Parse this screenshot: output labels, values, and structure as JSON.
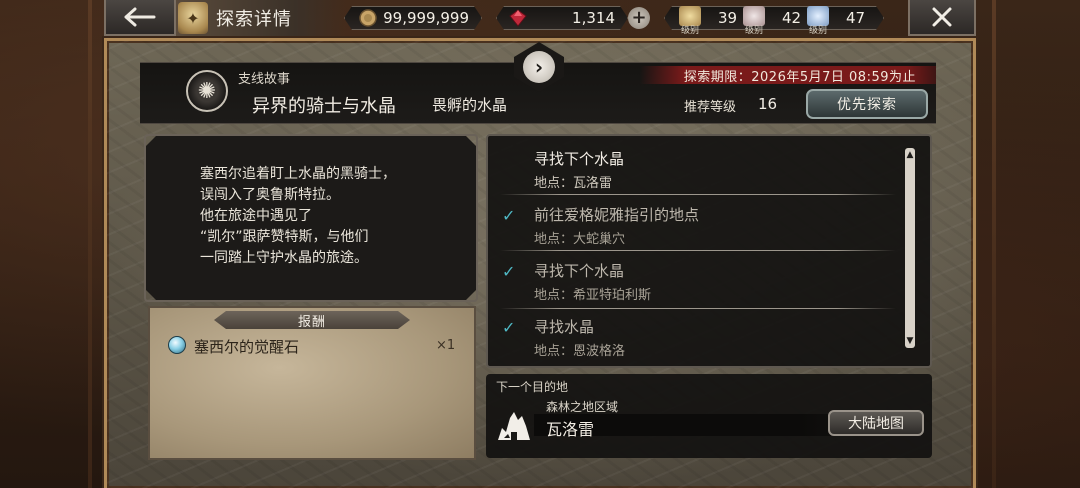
{
  "header": {
    "title": "探索详情",
    "gold": "99,999,999",
    "gems": "1,314",
    "ranks": [
      {
        "label": "级别",
        "value": "39",
        "icon": "gold-rank-badge-icon"
      },
      {
        "label": "级别",
        "value": "42",
        "icon": "silver-rank-badge-icon"
      },
      {
        "label": "级别",
        "value": "47",
        "icon": "blue-rank-badge-icon"
      }
    ]
  },
  "story": {
    "type": "支线故事",
    "title": "异界的骑士与水晶",
    "subtitle": "畏孵的水晶",
    "deadline": "探索期限：2026年5月7日 08:59为止",
    "recommended_label": "推荐等级",
    "recommended_level": "16",
    "priority_button": "优先探索",
    "description_lines": [
      "塞西尔追着盯上水晶的黑骑士，",
      "误闯入了奥鲁斯特拉。",
      "他在旅途中遇见了",
      "“凯尔”跟萨赞特斯，与他们",
      "一同踏上守护水晶的旅途。"
    ]
  },
  "reward": {
    "tab_label": "报酬",
    "item_name": "塞西尔的觉醒石",
    "item_qty": "×1"
  },
  "quests": [
    {
      "title": "寻找下个水晶",
      "location": "地点：瓦洛雷",
      "done": false
    },
    {
      "title": "前往爱格妮雅指引的地点",
      "location": "地点：大蛇巢穴",
      "done": true
    },
    {
      "title": "寻找下个水晶",
      "location": "地点：希亚特珀利斯",
      "done": true
    },
    {
      "title": "寻找水晶",
      "location": "地点：恩波格洛",
      "done": true
    }
  ],
  "destination": {
    "label": "下一个目的地",
    "region": "森林之地区域",
    "name": "瓦洛雷",
    "map_button": "大陆地图"
  },
  "colors": {
    "deadline_bg": "#7a1a1a",
    "check": "#4fb8c4",
    "frame_gold": "#b08a58"
  }
}
